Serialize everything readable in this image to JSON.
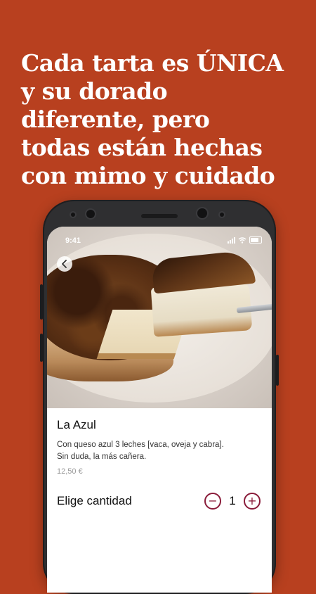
{
  "headline": {
    "lines": [
      "Cada tarta es ÚNICA",
      "y su dorado",
      "diferente, pero",
      "todas están hechas",
      "con mimo y cuidado"
    ]
  },
  "status_bar": {
    "time": "9:41",
    "icons": [
      "signal-icon",
      "wifi-icon",
      "battery-icon"
    ]
  },
  "product": {
    "back_icon": "chevron-left-icon",
    "name": "La Azul",
    "description": "Con queso azul 3 leches [vaca, oveja y cabra].  Sin duda, la más cañera.",
    "price": "12,50 €"
  },
  "quantity": {
    "label": "Elige cantidad",
    "minus_symbol": "−",
    "value": "1",
    "plus_symbol": "+",
    "accent_color": "#8a1c3a"
  },
  "colors": {
    "background": "#b8401f",
    "headline_text": "#ffffff"
  }
}
